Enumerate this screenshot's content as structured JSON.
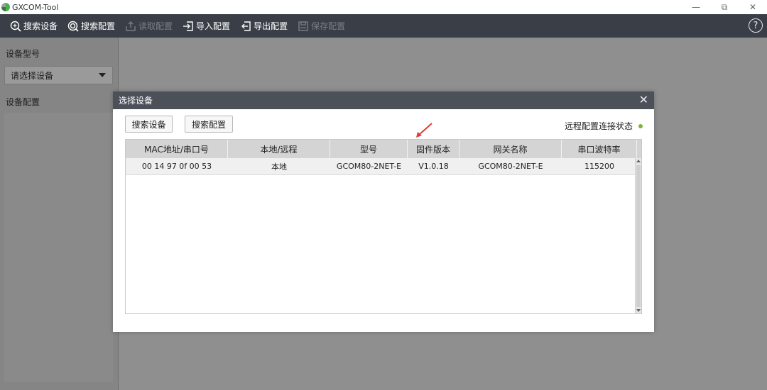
{
  "app": {
    "title": "GXCOM-Tool"
  },
  "window_controls": {
    "minimize": "—",
    "maximize": "⧉",
    "close": "✕"
  },
  "toolbar": {
    "buttons": [
      {
        "label": "搜索设备",
        "icon": "search-device-icon",
        "enabled": true
      },
      {
        "label": "搜索配置",
        "icon": "search-config-icon",
        "enabled": true
      },
      {
        "label": "读取配置",
        "icon": "read-config-icon",
        "enabled": false
      },
      {
        "label": "导入配置",
        "icon": "import-config-icon",
        "enabled": true
      },
      {
        "label": "导出配置",
        "icon": "export-config-icon",
        "enabled": true
      },
      {
        "label": "保存配置",
        "icon": "save-config-icon",
        "enabled": false
      }
    ],
    "help_label": "?"
  },
  "sidebar": {
    "device_model_label": "设备型号",
    "device_select_value": "请选择设备",
    "device_config_label": "设备配置"
  },
  "dialog": {
    "title": "选择设备",
    "close_label": "✕",
    "search_device_button": "搜索设备",
    "search_config_button": "搜索配置",
    "remote_status_label": "远程配置连接状态",
    "status_color": "#7cb342",
    "table": {
      "columns": [
        "MAC地址/串口号",
        "本地/远程",
        "型号",
        "固件版本",
        "网关名称",
        "串口波特率"
      ],
      "rows": [
        [
          "00 14 97 0f 00 53",
          "本地",
          "GCOM80-2NET-E",
          "V1.0.18",
          "GCOM80-2NET-E",
          "115200"
        ]
      ]
    }
  },
  "colors": {
    "toolbar_bg": "#3a3f47",
    "dialog_header_bg": "#4b5059",
    "annotation_arrow": "#e53935"
  }
}
